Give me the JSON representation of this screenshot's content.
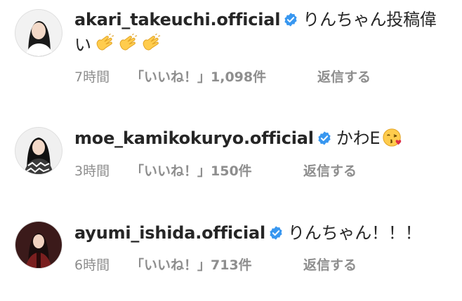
{
  "comments": [
    {
      "username": "akari_takeuchi.official",
      "verified": true,
      "text": "りんちゃん投稿偉い",
      "emojis": [
        "clapping-hands",
        "clapping-hands",
        "clapping-hands"
      ],
      "time": "7時間",
      "likes": "「いいね！」1,098件",
      "reply": "返信する"
    },
    {
      "username": "moe_kamikokuryo.official",
      "verified": true,
      "text": "かわE",
      "emojis": [
        "face-blowing-a-kiss"
      ],
      "time": "3時間",
      "likes": "「いいね！」150件",
      "reply": "返信する"
    },
    {
      "username": "ayumi_ishida.official",
      "verified": true,
      "text": "りんちゃん！！！",
      "emojis": [],
      "time": "6時間",
      "likes": "「いいね！」713件",
      "reply": "返信する"
    }
  ],
  "colors": {
    "verified_blue": "#3897f0",
    "meta_gray": "#8e8e8e",
    "text": "#262626"
  }
}
